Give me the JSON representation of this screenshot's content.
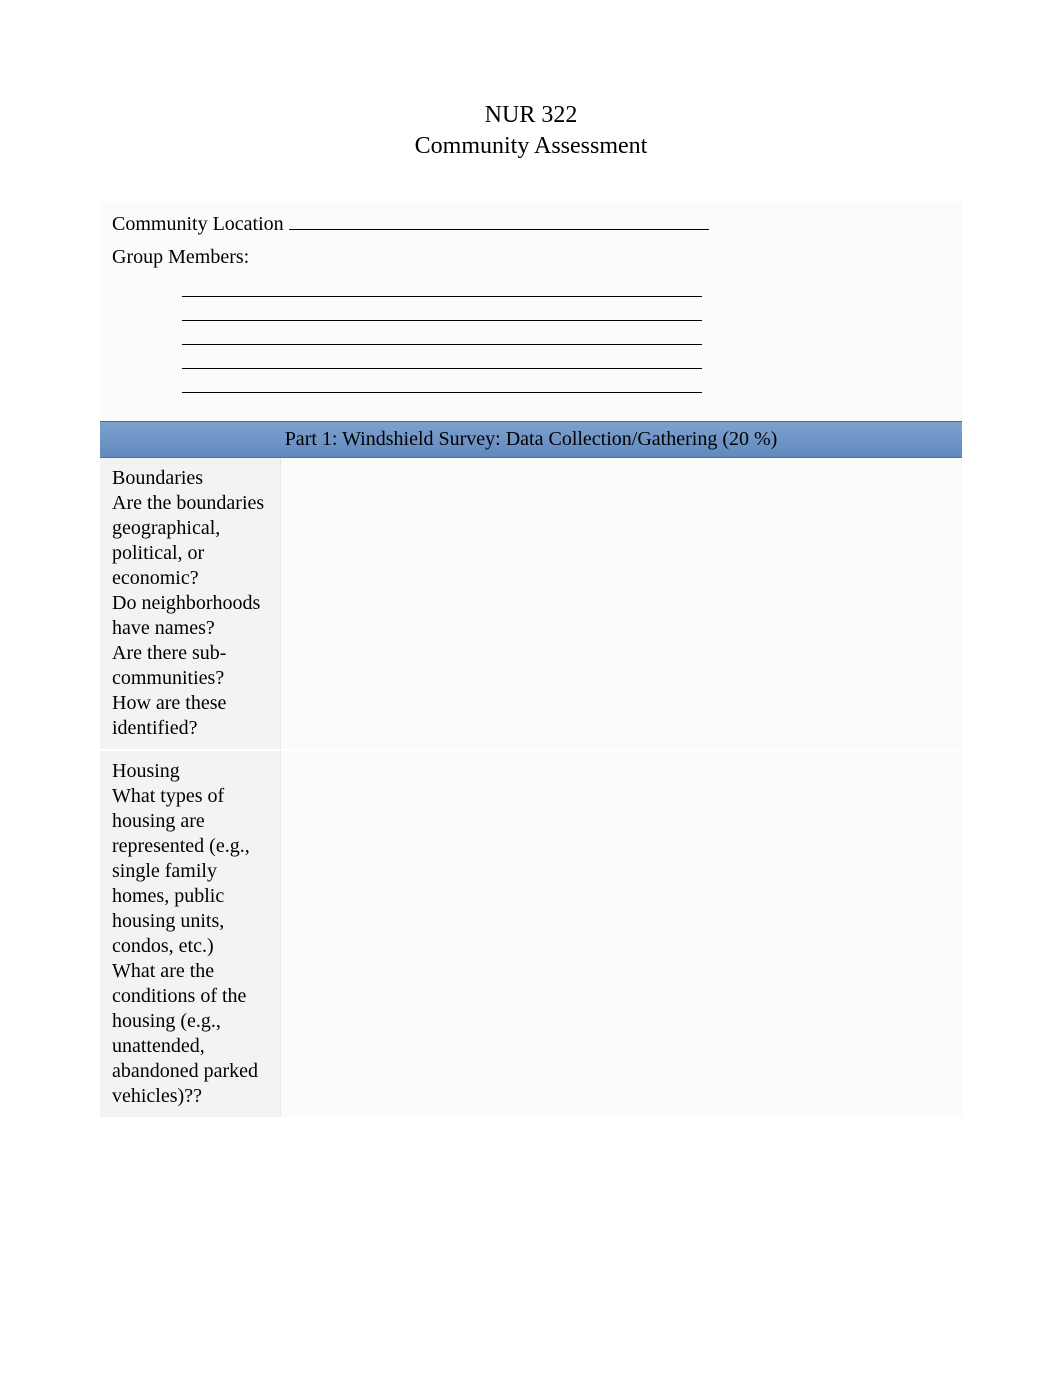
{
  "header": {
    "course": "NUR 322",
    "title": "Community Assessment"
  },
  "form": {
    "location_label": "Community Location",
    "location_value": "",
    "members_label": "Group Members:",
    "members": [
      "",
      "",
      "",
      "",
      ""
    ]
  },
  "section": {
    "part1_title": "Part 1: Windshield Survey: Data Collection/Gathering (20 %)"
  },
  "survey": {
    "rows": [
      {
        "heading": "Boundaries",
        "body": "Are the boundaries geographical, political, or economic?\nDo neighborhoods have names?\nAre there sub-communities? How are these identified?",
        "answer": ""
      },
      {
        "heading": "Housing",
        "body": "What types of housing are represented (e.g., single family homes, public housing units, condos, etc.)\nWhat are the conditions of the housing (e.g., unattended, abandoned parked vehicles)??",
        "answer": ""
      }
    ]
  }
}
